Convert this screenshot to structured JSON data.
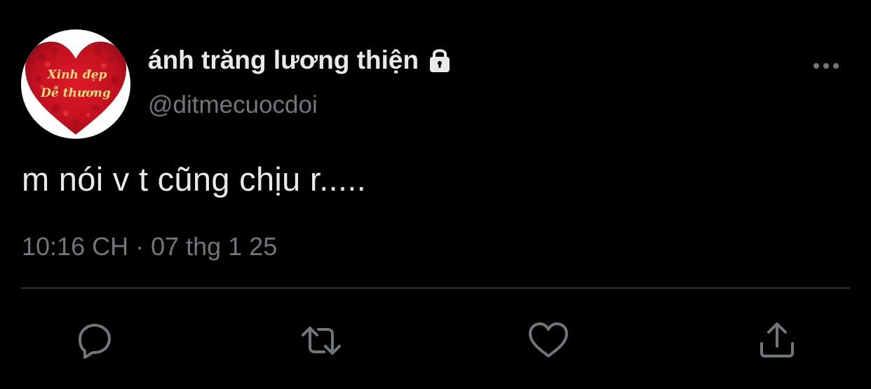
{
  "profile": {
    "avatar_text_line1": "Xinh đẹp",
    "avatar_text_line2": "Dễ thương",
    "display_name": "ánh trăng lương thiện",
    "handle": "@ditmecuocdoi",
    "protected_icon": "lock-icon"
  },
  "tweet": {
    "text": "m nói v t cũng chịu r.....",
    "timestamp": "10:16 CH · 07 thg 1 25"
  },
  "actions": [
    {
      "name": "reply",
      "icon": "speech-bubble-icon"
    },
    {
      "name": "retweet",
      "icon": "retweet-icon"
    },
    {
      "name": "like",
      "icon": "heart-icon"
    },
    {
      "name": "share",
      "icon": "share-upload-icon"
    }
  ],
  "colors": {
    "background": "#000000",
    "primary_text": "#e7e9ea",
    "secondary_text": "#71767b",
    "divider": "#2f3336",
    "avatar_heart": "#c8102e",
    "avatar_text": "#f7e27a"
  }
}
